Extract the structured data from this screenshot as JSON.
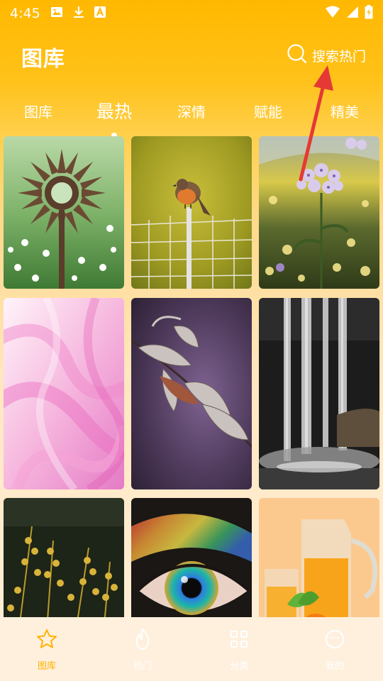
{
  "status_bar": {
    "time": "4:45",
    "icons": [
      "image-icon",
      "download-icon",
      "a-badge-icon",
      "wifi-icon",
      "signal-icon",
      "battery-icon"
    ]
  },
  "header": {
    "title": "图库",
    "search_label": "搜索热门"
  },
  "tabs": [
    {
      "label": "图库",
      "active": false
    },
    {
      "label": "最热",
      "active": true
    },
    {
      "label": "深情",
      "active": false
    },
    {
      "label": "赋能",
      "active": false
    },
    {
      "label": "精美",
      "active": false
    }
  ],
  "gallery": [
    {
      "subject": "metal sunburst sculpture among daisies"
    },
    {
      "subject": "robin bird on wire fence"
    },
    {
      "subject": "purple phlox flowers"
    },
    {
      "subject": "pink silk smoke"
    },
    {
      "subject": "dry leaves on purple background"
    },
    {
      "subject": "waterfall in dark forest"
    },
    {
      "subject": "golden goldenrod plants"
    },
    {
      "subject": "rainbow eye close-up"
    },
    {
      "subject": "orange juice jug and glass"
    }
  ],
  "bottom_nav": [
    {
      "label": "图库",
      "icon": "star-icon",
      "active": true
    },
    {
      "label": "热门",
      "icon": "flame-icon",
      "active": false
    },
    {
      "label": "分类",
      "icon": "grid-icon",
      "active": false
    },
    {
      "label": "我的",
      "icon": "smile-icon",
      "active": false
    }
  ],
  "colors": {
    "accent": "#FFB300",
    "header_top": "#FFB800",
    "annotation": "#E53935"
  }
}
